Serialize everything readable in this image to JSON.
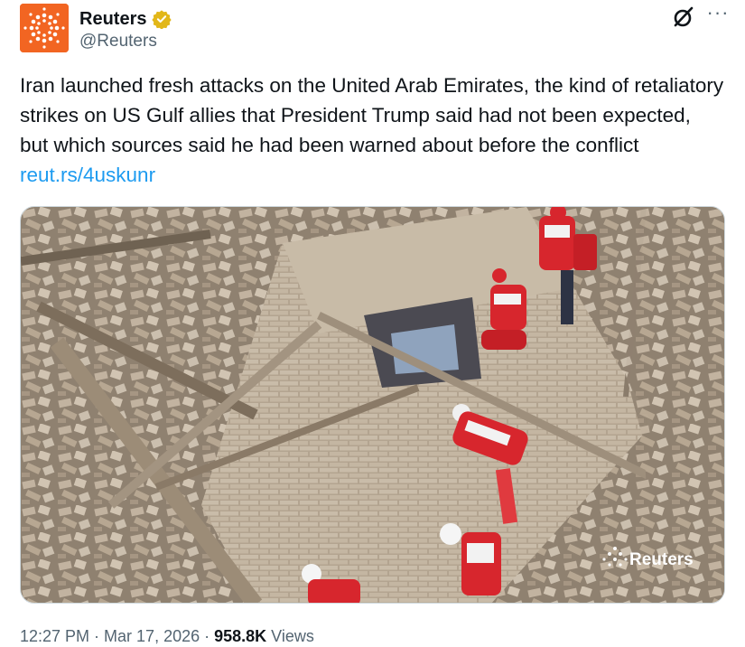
{
  "account": {
    "display_name": "Reuters",
    "handle": "@Reuters",
    "verified_badge_color": "#e2b719",
    "avatar_color": "#f26522"
  },
  "header_actions": {
    "grok_icon": "grok-icon",
    "more_icon": "more-icon",
    "more_glyph": "···"
  },
  "tweet": {
    "text": "Iran launched fresh attacks on the United Arab Emirates, the kind of retaliatory strikes on US Gulf allies that President Trump said had not been expected, but which sources said he had been warned about before the conflict ",
    "link_text": "reut.rs/4uskunr",
    "link_color": "#1d9bf0"
  },
  "photo": {
    "watermark": "Reuters",
    "description_colors": {
      "rubble": "#b8aa98",
      "vest": "#d7262d"
    }
  },
  "meta": {
    "time": "12:27 PM",
    "separator": " · ",
    "date": "Mar 17, 2026",
    "views_count": "958.8K",
    "views_label": " Views"
  }
}
